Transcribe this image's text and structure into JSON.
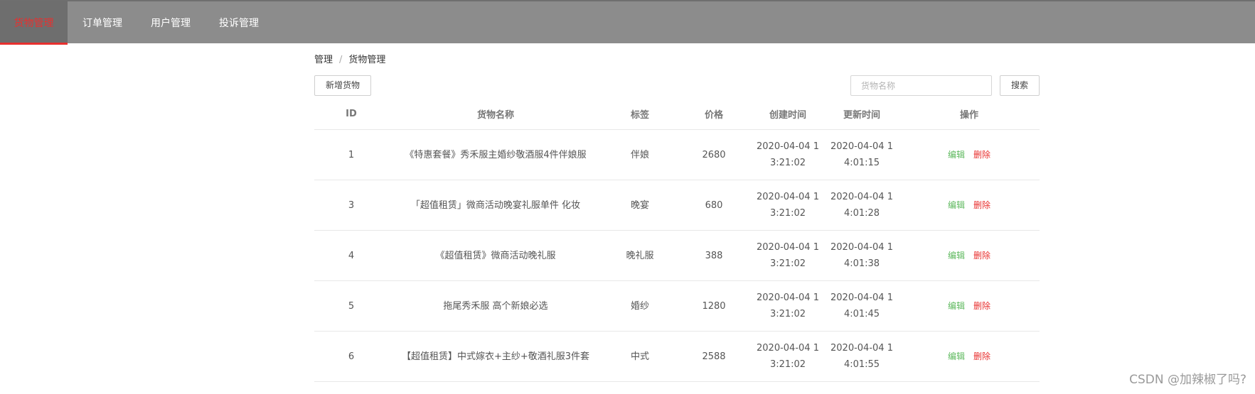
{
  "nav": {
    "tabs": [
      {
        "label": "货物管理",
        "active": true
      },
      {
        "label": "订单管理",
        "active": false
      },
      {
        "label": "用户管理",
        "active": false
      },
      {
        "label": "投诉管理",
        "active": false
      }
    ]
  },
  "breadcrumb": {
    "root": "管理",
    "separator": "/",
    "current": "货物管理"
  },
  "toolbar": {
    "add_label": "新增货物",
    "search_placeholder": "货物名称",
    "search_value": "",
    "search_label": "搜索"
  },
  "table": {
    "headers": {
      "id": "ID",
      "name": "货物名称",
      "tag": "标签",
      "price": "价格",
      "created": "创建时间",
      "updated": "更新时间",
      "ops": "操作"
    },
    "rows": [
      {
        "id": "1",
        "name": "《特惠套餐》秀禾服主婚纱敬酒服4件伴娘服",
        "tag": "伴娘",
        "price": "2680",
        "created": "2020-04-04 13:21:02",
        "updated": "2020-04-04 14:01:15",
        "edit": "编辑",
        "delete": "删除"
      },
      {
        "id": "3",
        "name": "「超值租赁」微商活动晚宴礼服单件 化妆",
        "tag": "晚宴",
        "price": "680",
        "created": "2020-04-04 13:21:02",
        "updated": "2020-04-04 14:01:28",
        "edit": "编辑",
        "delete": "删除"
      },
      {
        "id": "4",
        "name": "《超值租赁》微商活动晚礼服",
        "tag": "晚礼服",
        "price": "388",
        "created": "2020-04-04 13:21:02",
        "updated": "2020-04-04 14:01:38",
        "edit": "编辑",
        "delete": "删除"
      },
      {
        "id": "5",
        "name": "拖尾秀禾服 高个新娘必选",
        "tag": "婚纱",
        "price": "1280",
        "created": "2020-04-04 13:21:02",
        "updated": "2020-04-04 14:01:45",
        "edit": "编辑",
        "delete": "删除"
      },
      {
        "id": "6",
        "name": "【超值租赁】中式嫁衣+主纱+敬酒礼服3件套",
        "tag": "中式",
        "price": "2588",
        "created": "2020-04-04 13:21:02",
        "updated": "2020-04-04 14:01:55",
        "edit": "编辑",
        "delete": "删除"
      }
    ]
  },
  "watermark": "CSDN @加辣椒了吗?",
  "colors": {
    "nav_bg": "#8c8c8c",
    "active_accent": "#e8302f",
    "edit": "#5cb85c",
    "delete": "#e8302f"
  }
}
